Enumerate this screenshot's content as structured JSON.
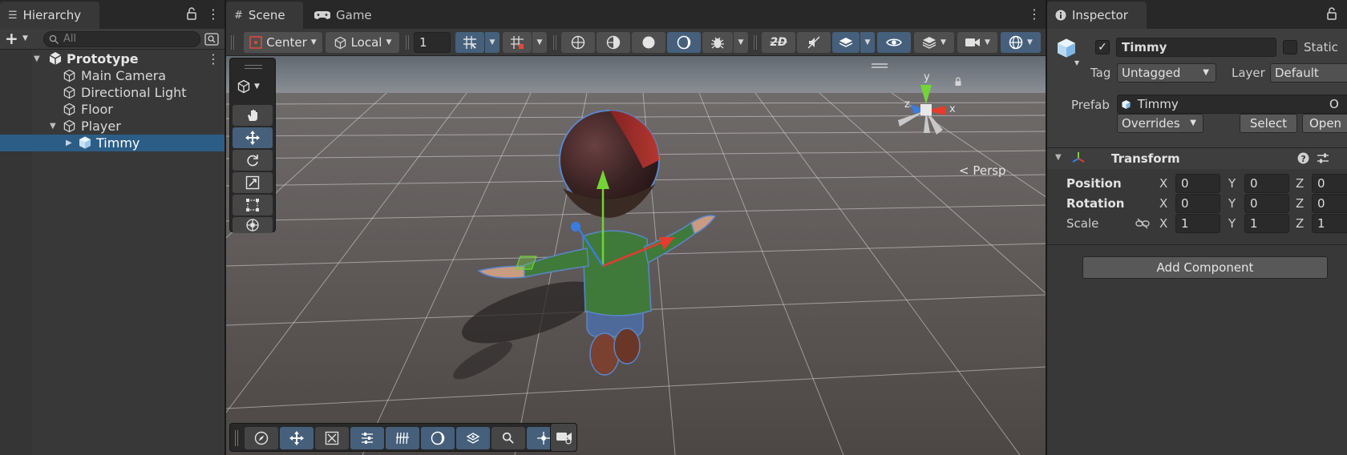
{
  "hierarchy": {
    "tab_label": "Hierarchy",
    "search_placeholder": "All",
    "items": [
      {
        "label": "Prototype",
        "level": 0,
        "expanded": true,
        "bold": true
      },
      {
        "label": "Main Camera",
        "level": 1
      },
      {
        "label": "Directional Light",
        "level": 1
      },
      {
        "label": "Floor",
        "level": 1
      },
      {
        "label": "Player",
        "level": 1,
        "expanded": true
      },
      {
        "label": "Timmy",
        "level": 2,
        "selected": true,
        "prefab": true
      }
    ]
  },
  "scene": {
    "tabs": [
      {
        "label": "Scene",
        "active": true,
        "icon": "grid-icon"
      },
      {
        "label": "Game",
        "active": false,
        "icon": "gamepad-icon"
      }
    ],
    "pivot_label": "Center",
    "space_label": "Local",
    "grid_snap_value": "1",
    "projection_label": "< Persp",
    "gizmo_axes": {
      "x": "x",
      "y": "y",
      "z": "z"
    }
  },
  "inspector": {
    "tab_label": "Inspector",
    "object_name": "Timmy",
    "active": true,
    "static_label": "Static",
    "tag_label": "Tag",
    "tag_value": "Untagged",
    "layer_label": "Layer",
    "layer_value": "Default",
    "prefab_label": "Prefab",
    "prefab_value": "Timmy",
    "prefab_extra": "O",
    "overrides_label": "Overrides",
    "select_label": "Select",
    "open_label": "Open",
    "transform": {
      "title": "Transform",
      "rows": [
        {
          "label": "Position",
          "bold": true,
          "x": "0",
          "y": "0",
          "z": "0"
        },
        {
          "label": "Rotation",
          "bold": true,
          "x": "0",
          "y": "0",
          "z": "0"
        },
        {
          "label": "Scale",
          "bold": false,
          "x": "1",
          "y": "1",
          "z": "1"
        }
      ],
      "axis_x": "X",
      "axis_y": "Y",
      "axis_z": "Z"
    },
    "add_component_label": "Add Component"
  },
  "colors": {
    "selection": "#2c5d87",
    "active_button": "#46607c",
    "panel_bg": "#383838",
    "tab_strip": "#282828",
    "axis_x": "#e63b2e",
    "axis_y": "#72d436",
    "axis_z": "#3a7de0"
  }
}
